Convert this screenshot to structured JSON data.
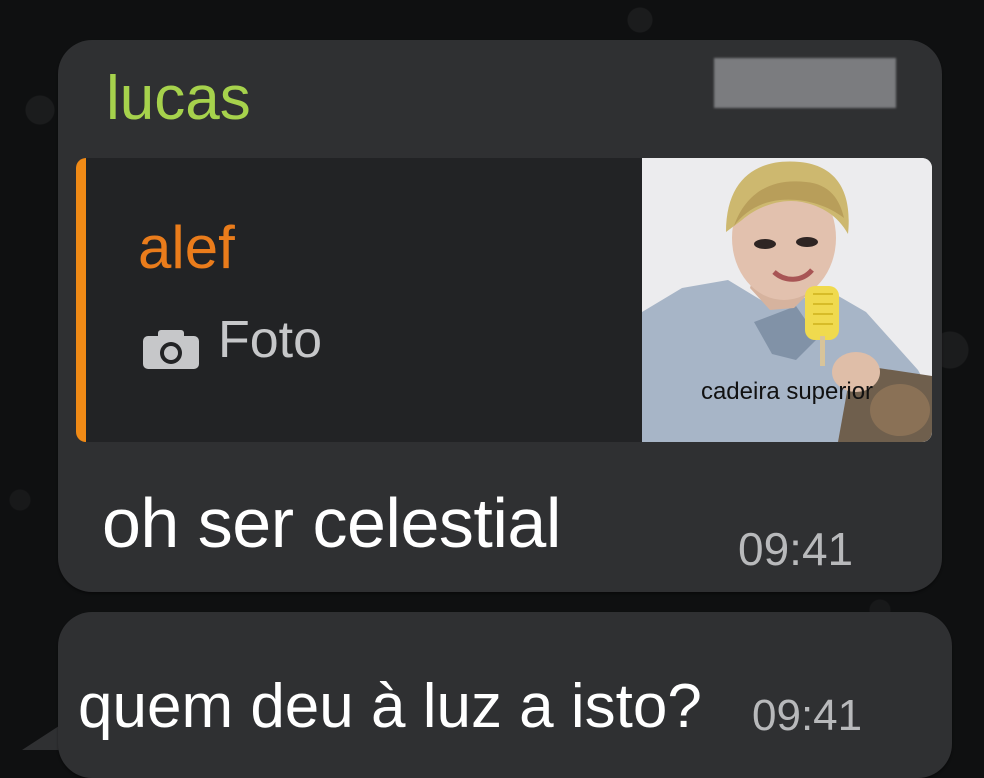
{
  "chat": {
    "messages": [
      {
        "sender": "lucas",
        "reply_to": {
          "name": "alef",
          "type_label": "Foto",
          "icon": "camera-icon",
          "image_caption": "cadeira superior"
        },
        "text": "oh ser celestial",
        "time": "09:41"
      },
      {
        "text": "quem deu à luz a isto?",
        "time": "09:41"
      }
    ]
  },
  "colors": {
    "background": "#0f1011",
    "bubble": "#2f3032",
    "reply_box": "#222325",
    "sender_name": "#a6d24c",
    "reply_name": "#ea7c1b",
    "reply_accent": "#f08a16",
    "message_text": "#ffffff",
    "time_text": "#b8b9bb"
  }
}
